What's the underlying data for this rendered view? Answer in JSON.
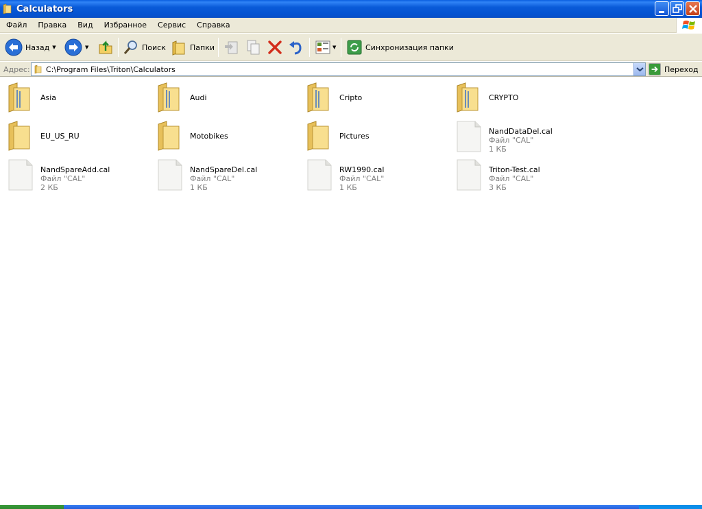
{
  "window": {
    "title": "Calculators",
    "icon": "folder-icon"
  },
  "menu": {
    "items": [
      "Файл",
      "Правка",
      "Вид",
      "Избранное",
      "Сервис",
      "Справка"
    ]
  },
  "toolbar": {
    "back_label": "Назад",
    "search_label": "Поиск",
    "folders_label": "Папки",
    "sync_label": "Синхронизация папки"
  },
  "address": {
    "label": "Адрес:",
    "path": "C:\\Program Files\\Triton\\Calculators",
    "go_label": "Переход"
  },
  "items": [
    {
      "name": "Asia",
      "kind": "folder"
    },
    {
      "name": "Audi",
      "kind": "folder"
    },
    {
      "name": "Cripto",
      "kind": "folder"
    },
    {
      "name": "CRYPTO",
      "kind": "folder"
    },
    {
      "name": "EU_US_RU",
      "kind": "folder"
    },
    {
      "name": "Motobikes",
      "kind": "folder"
    },
    {
      "name": "Pictures",
      "kind": "folder"
    },
    {
      "name": "NandDataDel.cal",
      "kind": "file",
      "type": "Файл \"CAL\"",
      "size": "1 КБ"
    },
    {
      "name": "NandSpareAdd.cal",
      "kind": "file",
      "type": "Файл \"CAL\"",
      "size": "2 КБ"
    },
    {
      "name": "NandSpareDel.cal",
      "kind": "file",
      "type": "Файл \"CAL\"",
      "size": "1 КБ"
    },
    {
      "name": "RW1990.cal",
      "kind": "file",
      "type": "Файл \"CAL\"",
      "size": "1 КБ"
    },
    {
      "name": "Triton-Test.cal",
      "kind": "file",
      "type": "Файл \"CAL\"",
      "size": "3 КБ"
    }
  ],
  "colors": {
    "titlebar": "#0a5bd9",
    "chrome": "#ece9d8",
    "folder": "#f5d97a",
    "close": "#c3401b"
  }
}
